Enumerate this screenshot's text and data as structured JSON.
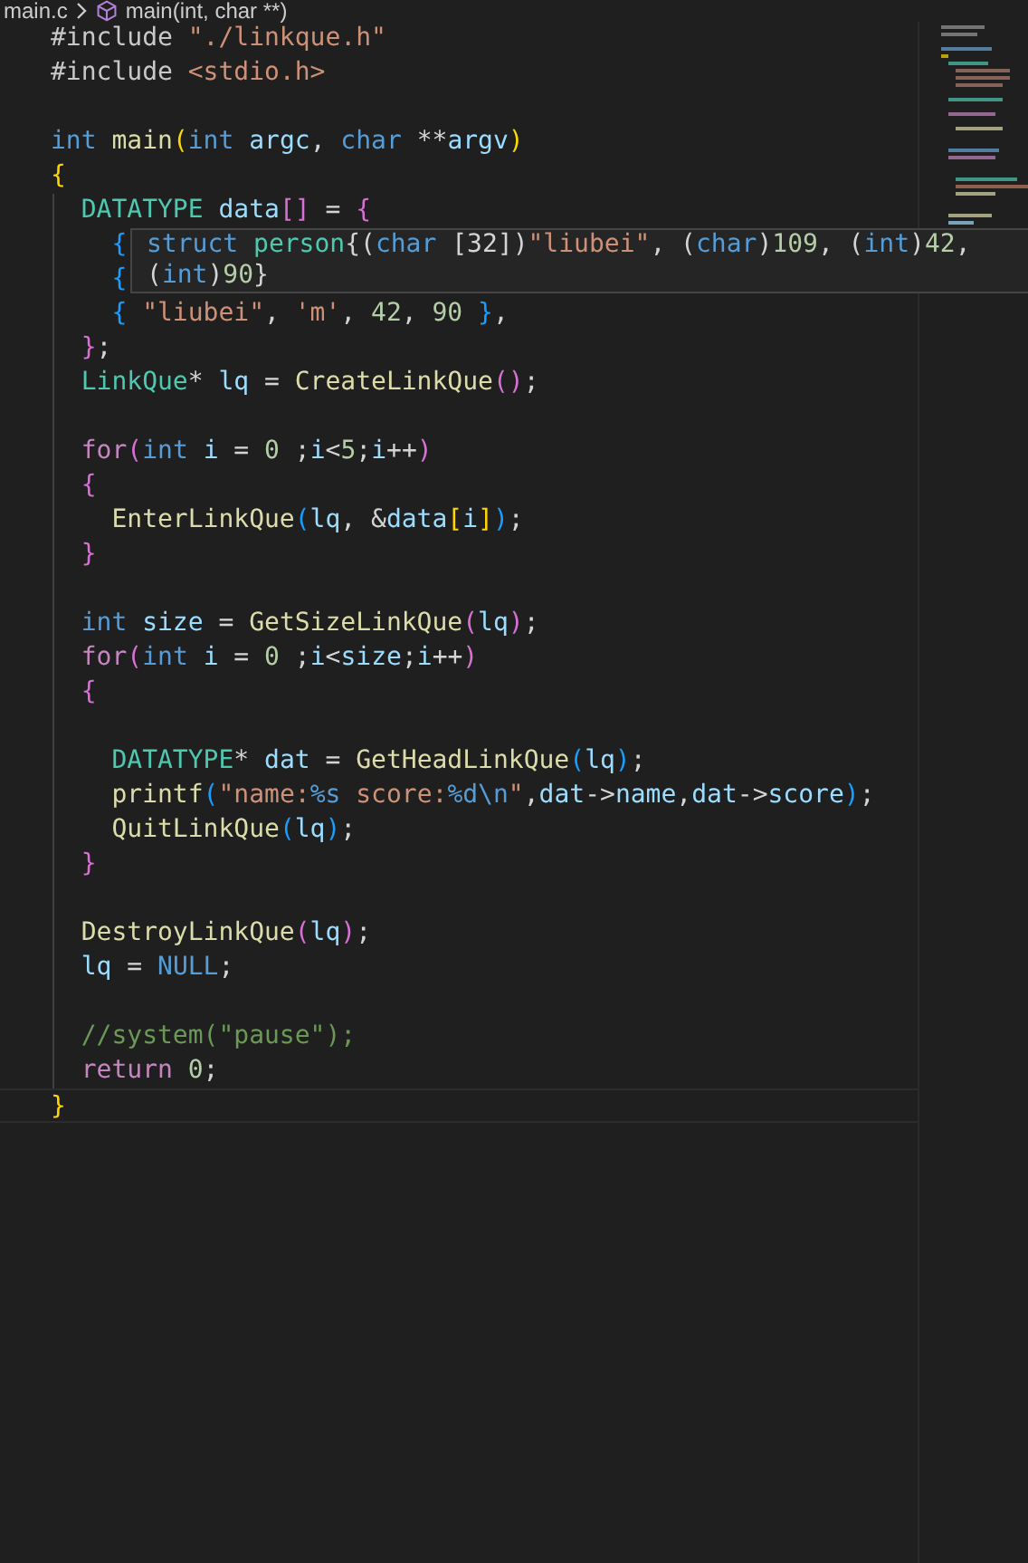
{
  "breadcrumb": {
    "file": "main.c",
    "symbol": "main(int, char **)"
  },
  "code_lines": [
    {
      "kind": "code",
      "tokens": [
        {
          "kind": "macro",
          "text": "#include "
        },
        {
          "kind": "str",
          "text": "\"./linkque.h\""
        }
      ]
    },
    {
      "kind": "code",
      "tokens": [
        {
          "kind": "macro",
          "text": "#include "
        },
        {
          "kind": "str",
          "text": "<stdio.h>"
        }
      ]
    },
    {
      "kind": "blank"
    },
    {
      "kind": "code",
      "tokens": [
        {
          "kind": "kw",
          "text": "int "
        },
        {
          "kind": "fn",
          "text": "main"
        },
        {
          "kind": "b1",
          "text": "("
        },
        {
          "kind": "kw",
          "text": "int "
        },
        {
          "kind": "var",
          "text": "argc"
        },
        {
          "kind": "p",
          "text": ", "
        },
        {
          "kind": "kw",
          "text": "char "
        },
        {
          "kind": "p",
          "text": "**"
        },
        {
          "kind": "var",
          "text": "argv"
        },
        {
          "kind": "b1",
          "text": ")"
        }
      ]
    },
    {
      "kind": "code",
      "tokens": [
        {
          "kind": "b1",
          "text": "{"
        }
      ]
    },
    {
      "kind": "code",
      "tokens": [
        {
          "kind": "type",
          "text": "  DATATYPE "
        },
        {
          "kind": "var",
          "text": "data"
        },
        {
          "kind": "b2",
          "text": "[]"
        },
        {
          "kind": "p",
          "text": " = "
        },
        {
          "kind": "b2",
          "text": "{"
        }
      ]
    },
    {
      "kind": "code",
      "tokens": [
        {
          "kind": "b3",
          "text": "    {"
        }
      ]
    },
    {
      "kind": "code",
      "tokens": [
        {
          "kind": "b3",
          "text": "    {"
        }
      ]
    },
    {
      "kind": "code",
      "tokens": [
        {
          "kind": "b3",
          "text": "    { "
        },
        {
          "kind": "str",
          "text": "\"liubei\""
        },
        {
          "kind": "p",
          "text": ", "
        },
        {
          "kind": "str",
          "text": "'m'"
        },
        {
          "kind": "p",
          "text": ", "
        },
        {
          "kind": "num",
          "text": "42"
        },
        {
          "kind": "p",
          "text": ", "
        },
        {
          "kind": "num",
          "text": "90 "
        },
        {
          "kind": "b3",
          "text": "}"
        },
        {
          "kind": "p",
          "text": ","
        }
      ]
    },
    {
      "kind": "code",
      "tokens": [
        {
          "kind": "b2",
          "text": "  }"
        },
        {
          "kind": "p",
          "text": ";"
        }
      ]
    },
    {
      "kind": "code",
      "tokens": [
        {
          "kind": "type",
          "text": "  LinkQue"
        },
        {
          "kind": "p",
          "text": "* "
        },
        {
          "kind": "var",
          "text": "lq"
        },
        {
          "kind": "p",
          "text": " = "
        },
        {
          "kind": "fn",
          "text": "CreateLinkQue"
        },
        {
          "kind": "b2",
          "text": "()"
        },
        {
          "kind": "p",
          "text": ";"
        }
      ]
    },
    {
      "kind": "blank"
    },
    {
      "kind": "code",
      "tokens": [
        {
          "kind": "ctrl",
          "text": "  for"
        },
        {
          "kind": "b2",
          "text": "("
        },
        {
          "kind": "kw",
          "text": "int "
        },
        {
          "kind": "var",
          "text": "i"
        },
        {
          "kind": "p",
          "text": " = "
        },
        {
          "kind": "num",
          "text": "0"
        },
        {
          "kind": "p",
          "text": " ;"
        },
        {
          "kind": "var",
          "text": "i"
        },
        {
          "kind": "p",
          "text": "<"
        },
        {
          "kind": "num",
          "text": "5"
        },
        {
          "kind": "p",
          "text": ";"
        },
        {
          "kind": "var",
          "text": "i"
        },
        {
          "kind": "p",
          "text": "++"
        },
        {
          "kind": "b2",
          "text": ")"
        }
      ]
    },
    {
      "kind": "code",
      "tokens": [
        {
          "kind": "b2",
          "text": "  {"
        }
      ]
    },
    {
      "kind": "code",
      "tokens": [
        {
          "kind": "fn",
          "text": "    EnterLinkQue"
        },
        {
          "kind": "b3",
          "text": "("
        },
        {
          "kind": "var",
          "text": "lq"
        },
        {
          "kind": "p",
          "text": ", &"
        },
        {
          "kind": "var",
          "text": "data"
        },
        {
          "kind": "b1",
          "text": "["
        },
        {
          "kind": "var",
          "text": "i"
        },
        {
          "kind": "b1",
          "text": "]"
        },
        {
          "kind": "b3",
          "text": ")"
        },
        {
          "kind": "p",
          "text": ";"
        }
      ]
    },
    {
      "kind": "code",
      "tokens": [
        {
          "kind": "b2",
          "text": "  }"
        }
      ]
    },
    {
      "kind": "blank"
    },
    {
      "kind": "code",
      "tokens": [
        {
          "kind": "kw",
          "text": "  int "
        },
        {
          "kind": "var",
          "text": "size"
        },
        {
          "kind": "p",
          "text": " = "
        },
        {
          "kind": "fn",
          "text": "GetSizeLinkQue"
        },
        {
          "kind": "b2",
          "text": "("
        },
        {
          "kind": "var",
          "text": "lq"
        },
        {
          "kind": "b2",
          "text": ")"
        },
        {
          "kind": "p",
          "text": ";"
        }
      ]
    },
    {
      "kind": "code",
      "tokens": [
        {
          "kind": "ctrl",
          "text": "  for"
        },
        {
          "kind": "b2",
          "text": "("
        },
        {
          "kind": "kw",
          "text": "int "
        },
        {
          "kind": "var",
          "text": "i"
        },
        {
          "kind": "p",
          "text": " = "
        },
        {
          "kind": "num",
          "text": "0"
        },
        {
          "kind": "p",
          "text": " ;"
        },
        {
          "kind": "var",
          "text": "i"
        },
        {
          "kind": "p",
          "text": "<"
        },
        {
          "kind": "var",
          "text": "size"
        },
        {
          "kind": "p",
          "text": ";"
        },
        {
          "kind": "var",
          "text": "i"
        },
        {
          "kind": "p",
          "text": "++"
        },
        {
          "kind": "b2",
          "text": ")"
        }
      ]
    },
    {
      "kind": "code",
      "tokens": [
        {
          "kind": "b2",
          "text": "  {"
        }
      ]
    },
    {
      "kind": "blank"
    },
    {
      "kind": "code",
      "tokens": [
        {
          "kind": "type",
          "text": "    DATATYPE"
        },
        {
          "kind": "p",
          "text": "* "
        },
        {
          "kind": "var",
          "text": "dat"
        },
        {
          "kind": "p",
          "text": " = "
        },
        {
          "kind": "fn",
          "text": "GetHeadLinkQue"
        },
        {
          "kind": "b3",
          "text": "("
        },
        {
          "kind": "var",
          "text": "lq"
        },
        {
          "kind": "b3",
          "text": ")"
        },
        {
          "kind": "p",
          "text": ";"
        }
      ]
    },
    {
      "kind": "code",
      "tokens": [
        {
          "kind": "fn",
          "text": "    printf"
        },
        {
          "kind": "b3",
          "text": "("
        },
        {
          "kind": "str",
          "text": "\"name:"
        },
        {
          "kind": "kw",
          "text": "%s"
        },
        {
          "kind": "str",
          "text": " score:"
        },
        {
          "kind": "kw",
          "text": "%d\\n"
        },
        {
          "kind": "str",
          "text": "\""
        },
        {
          "kind": "p",
          "text": ","
        },
        {
          "kind": "var",
          "text": "dat"
        },
        {
          "kind": "p",
          "text": "->"
        },
        {
          "kind": "var",
          "text": "name"
        },
        {
          "kind": "p",
          "text": ","
        },
        {
          "kind": "var",
          "text": "dat"
        },
        {
          "kind": "p",
          "text": "->"
        },
        {
          "kind": "var",
          "text": "score"
        },
        {
          "kind": "b3",
          "text": ")"
        },
        {
          "kind": "p",
          "text": ";"
        }
      ]
    },
    {
      "kind": "code",
      "tokens": [
        {
          "kind": "fn",
          "text": "    QuitLinkQue"
        },
        {
          "kind": "b3",
          "text": "("
        },
        {
          "kind": "var",
          "text": "lq"
        },
        {
          "kind": "b3",
          "text": ")"
        },
        {
          "kind": "p",
          "text": ";"
        }
      ]
    },
    {
      "kind": "code",
      "tokens": [
        {
          "kind": "b2",
          "text": "  }"
        }
      ]
    },
    {
      "kind": "blank"
    },
    {
      "kind": "code",
      "tokens": [
        {
          "kind": "fn",
          "text": "  DestroyLinkQue"
        },
        {
          "kind": "b2",
          "text": "("
        },
        {
          "kind": "var",
          "text": "lq"
        },
        {
          "kind": "b2",
          "text": ")"
        },
        {
          "kind": "p",
          "text": ";"
        }
      ]
    },
    {
      "kind": "code",
      "tokens": [
        {
          "kind": "var",
          "text": "  lq"
        },
        {
          "kind": "p",
          "text": " = "
        },
        {
          "kind": "kw",
          "text": "NULL"
        },
        {
          "kind": "p",
          "text": ";"
        }
      ]
    },
    {
      "kind": "blank"
    },
    {
      "kind": "code",
      "tokens": [
        {
          "kind": "comment",
          "text": "  //system(\"pause\");"
        }
      ]
    },
    {
      "kind": "code",
      "tokens": [
        {
          "kind": "ctrl",
          "text": "  return "
        },
        {
          "kind": "num",
          "text": "0"
        },
        {
          "kind": "p",
          "text": ";"
        }
      ]
    },
    {
      "kind": "code",
      "tokens": [
        {
          "kind": "b1",
          "text": "}"
        }
      ]
    }
  ],
  "hover_tooltip": [
    {
      "tokens": [
        {
          "kind": "kw",
          "text": "struct "
        },
        {
          "kind": "type",
          "text": "person"
        },
        {
          "kind": "p",
          "text": "{("
        },
        {
          "kind": "kw",
          "text": "char"
        },
        {
          "kind": "p",
          "text": " [32])"
        },
        {
          "kind": "str",
          "text": "\"liubei\""
        },
        {
          "kind": "p",
          "text": ", ("
        },
        {
          "kind": "kw",
          "text": "char"
        },
        {
          "kind": "p",
          "text": ")"
        },
        {
          "kind": "num",
          "text": "109"
        },
        {
          "kind": "p",
          "text": ", ("
        },
        {
          "kind": "kw",
          "text": "int"
        },
        {
          "kind": "p",
          "text": ")"
        },
        {
          "kind": "num",
          "text": "42"
        },
        {
          "kind": "p",
          "text": ","
        }
      ]
    },
    {
      "tokens": [
        {
          "kind": "p",
          "text": "("
        },
        {
          "kind": "kw",
          "text": "int"
        },
        {
          "kind": "p",
          "text": ")"
        },
        {
          "kind": "num",
          "text": "90"
        },
        {
          "kind": "p",
          "text": "}"
        }
      ]
    }
  ]
}
